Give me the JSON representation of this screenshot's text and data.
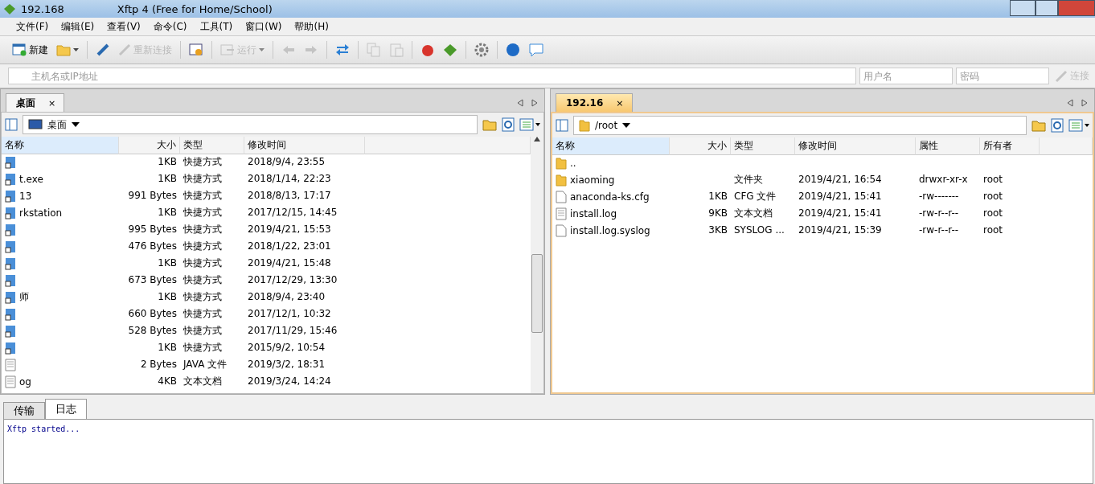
{
  "window": {
    "title_host": "192.168",
    "title": "Xftp 4 (Free for Home/School)"
  },
  "menu": [
    "文件(F)",
    "编辑(E)",
    "查看(V)",
    "命令(C)",
    "工具(T)",
    "窗口(W)",
    "帮助(H)"
  ],
  "toolbar": [
    {
      "kind": "new",
      "label": "新建",
      "disabled": false
    },
    {
      "kind": "open",
      "disabled": false
    },
    {
      "kind": "sep"
    },
    {
      "kind": "link",
      "disabled": false
    },
    {
      "kind": "reconnect",
      "label": "重新连接",
      "disabled": true
    },
    {
      "kind": "sep"
    },
    {
      "kind": "props",
      "disabled": false
    },
    {
      "kind": "sep"
    },
    {
      "kind": "run",
      "label": "运行",
      "disabled": true
    },
    {
      "kind": "sep"
    },
    {
      "kind": "back",
      "disabled": true
    },
    {
      "kind": "forward",
      "disabled": true
    },
    {
      "kind": "sep"
    },
    {
      "kind": "sync",
      "disabled": false
    },
    {
      "kind": "sep"
    },
    {
      "kind": "copy",
      "disabled": true
    },
    {
      "kind": "paste",
      "disabled": true
    },
    {
      "kind": "sep"
    },
    {
      "kind": "red",
      "disabled": false
    },
    {
      "kind": "green",
      "disabled": false
    },
    {
      "kind": "sep"
    },
    {
      "kind": "gear",
      "disabled": false
    },
    {
      "kind": "sep"
    },
    {
      "kind": "help",
      "disabled": false
    },
    {
      "kind": "chat",
      "disabled": false
    }
  ],
  "address": {
    "host_placeholder": "主机名或IP地址",
    "user_placeholder": "用户名",
    "password_placeholder": "密码",
    "connect": "连接"
  },
  "panes": [
    {
      "tab": {
        "label": "桌面",
        "selected": false,
        "close": "×"
      },
      "kind": "local",
      "path": "桌面",
      "columns": [
        "名称",
        "大小",
        "类型",
        "修改时间"
      ],
      "scrollbar": true,
      "rows": [
        {
          "kind": "shortcut",
          "size": "1KB",
          "type": "快捷方式",
          "modified": "2018/9/4, 23:55"
        },
        {
          "kind": "shortcut",
          "name": "t.exe",
          "size": "1KB",
          "type": "快捷方式",
          "modified": "2018/1/14, 22:23"
        },
        {
          "kind": "shortcut",
          "name": "13",
          "size": "991 Bytes",
          "type": "快捷方式",
          "modified": "2018/8/13, 17:17"
        },
        {
          "kind": "shortcut",
          "name": "rkstation",
          "size": "1KB",
          "type": "快捷方式",
          "modified": "2017/12/15, 14:45"
        },
        {
          "kind": "shortcut",
          "size": "995 Bytes",
          "type": "快捷方式",
          "modified": "2019/4/21, 15:53"
        },
        {
          "kind": "shortcut",
          "size": "476 Bytes",
          "type": "快捷方式",
          "modified": "2018/1/22, 23:01"
        },
        {
          "kind": "shortcut",
          "size": "1KB",
          "type": "快捷方式",
          "modified": "2019/4/21, 15:48"
        },
        {
          "kind": "shortcut",
          "size": "673 Bytes",
          "type": "快捷方式",
          "modified": "2017/12/29, 13:30"
        },
        {
          "kind": "shortcut",
          "name": "师",
          "size": "1KB",
          "type": "快捷方式",
          "modified": "2018/9/4, 23:40"
        },
        {
          "kind": "shortcut",
          "size": "660 Bytes",
          "type": "快捷方式",
          "modified": "2017/12/1, 10:32"
        },
        {
          "kind": "shortcut",
          "size": "528 Bytes",
          "type": "快捷方式",
          "modified": "2017/11/29, 15:46"
        },
        {
          "kind": "shortcut",
          "size": "1KB",
          "type": "快捷方式",
          "modified": "2015/9/2, 10:54"
        },
        {
          "kind": "text",
          "size": "2 Bytes",
          "type": "JAVA 文件",
          "modified": "2019/3/2, 18:31"
        },
        {
          "kind": "text",
          "name": "og",
          "size": "4KB",
          "type": "文本文档",
          "modified": "2019/3/24, 14:24"
        }
      ]
    },
    {
      "tab": {
        "label": "192.16",
        "selected": true,
        "close": "×"
      },
      "kind": "remote",
      "path": "/root",
      "columns": [
        "名称",
        "大小",
        "类型",
        "修改时间",
        "属性",
        "所有者"
      ],
      "scrollbar": false,
      "rows": [
        {
          "kind": "folder",
          "name": ".."
        },
        {
          "kind": "folder",
          "name": "xiaoming",
          "type": "文件夹",
          "modified": "2019/4/21, 16:54",
          "perms": "drwxr-xr-x",
          "owner": "root"
        },
        {
          "kind": "file",
          "name": "anaconda-ks.cfg",
          "size": "1KB",
          "type": "CFG 文件",
          "modified": "2019/4/21, 15:41",
          "perms": "-rw-------",
          "owner": "root"
        },
        {
          "kind": "text",
          "name": "install.log",
          "size": "9KB",
          "type": "文本文档",
          "modified": "2019/4/21, 15:41",
          "perms": "-rw-r--r--",
          "owner": "root"
        },
        {
          "kind": "file",
          "name": "install.log.syslog",
          "size": "3KB",
          "type": "SYSLOG ...",
          "modified": "2019/4/21, 15:39",
          "perms": "-rw-r--r--",
          "owner": "root"
        }
      ]
    }
  ],
  "bottom": {
    "tabs": [
      {
        "label": "传输",
        "selected": false
      },
      {
        "label": "日志",
        "selected": true
      }
    ],
    "log": "Xftp started..."
  }
}
